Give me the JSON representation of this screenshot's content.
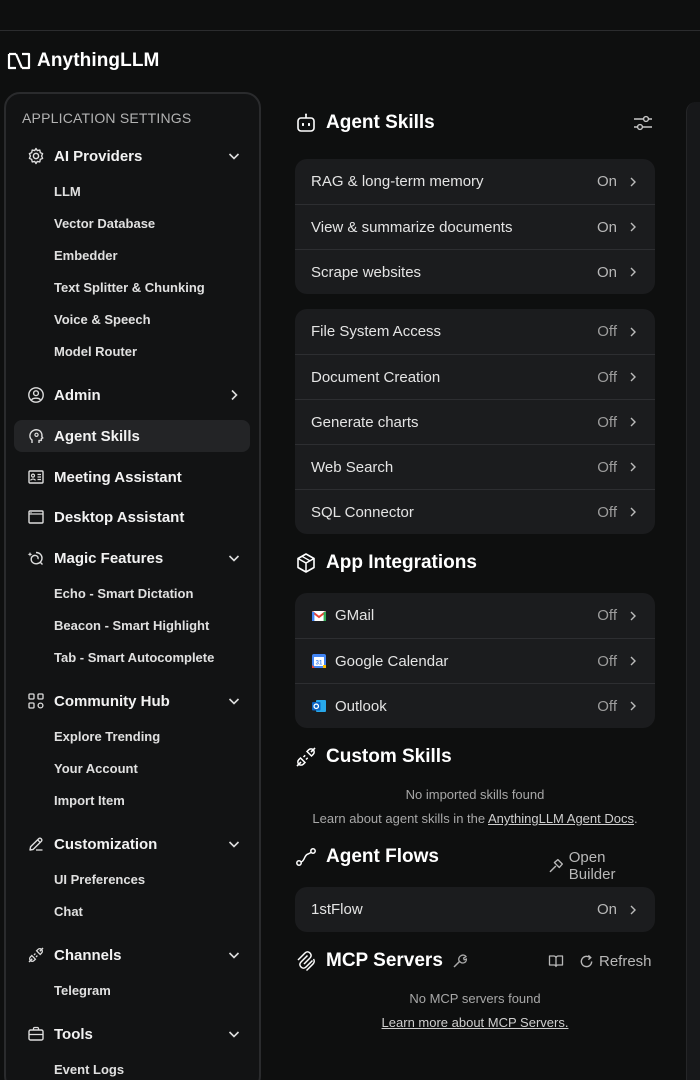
{
  "app": {
    "name": "AnythingLLM"
  },
  "sidebar": {
    "heading": "APPLICATION SETTINGS",
    "groups": [
      {
        "label": "AI Providers",
        "icon": "gear-icon",
        "expanded": true,
        "items": [
          "LLM",
          "Vector Database",
          "Embedder",
          "Text Splitter & Chunking",
          "Voice & Speech",
          "Model Router"
        ]
      },
      {
        "label": "Admin",
        "icon": "admin-user-icon",
        "expanded": false,
        "items": []
      },
      {
        "label": "Agent Skills",
        "icon": "agent-head-icon",
        "active": true,
        "items": []
      },
      {
        "label": "Meeting Assistant",
        "icon": "meeting-icon",
        "items": []
      },
      {
        "label": "Desktop Assistant",
        "icon": "desktop-window-icon",
        "items": []
      },
      {
        "label": "Magic Features",
        "icon": "magic-icon",
        "expanded": true,
        "items": [
          "Echo - Smart Dictation",
          "Beacon - Smart Highlight",
          "Tab - Smart Autocomplete"
        ]
      },
      {
        "label": "Community Hub",
        "icon": "community-grid-icon",
        "expanded": true,
        "items": [
          "Explore Trending",
          "Your Account",
          "Import Item"
        ]
      },
      {
        "label": "Customization",
        "icon": "pencil-icon",
        "expanded": true,
        "items": [
          "UI Preferences",
          "Chat"
        ]
      },
      {
        "label": "Channels",
        "icon": "plug-icon",
        "expanded": true,
        "items": [
          "Telegram"
        ]
      },
      {
        "label": "Tools",
        "icon": "briefcase-icon",
        "expanded": true,
        "items": [
          "Event Logs"
        ]
      }
    ]
  },
  "agent_skills": {
    "title": "Agent Skills",
    "group1": [
      {
        "label": "RAG & long-term memory",
        "status": "On"
      },
      {
        "label": "View & summarize documents",
        "status": "On"
      },
      {
        "label": "Scrape websites",
        "status": "On"
      }
    ],
    "group2": [
      {
        "label": "File System Access",
        "status": "Off"
      },
      {
        "label": "Document Creation",
        "status": "Off"
      },
      {
        "label": "Generate charts",
        "status": "Off"
      },
      {
        "label": "Web Search",
        "status": "Off"
      },
      {
        "label": "SQL Connector",
        "status": "Off"
      }
    ]
  },
  "app_integrations": {
    "title": "App Integrations",
    "items": [
      {
        "label": "GMail",
        "status": "Off",
        "icon": "gmail-icon"
      },
      {
        "label": "Google Calendar",
        "status": "Off",
        "icon": "google-calendar-icon"
      },
      {
        "label": "Outlook",
        "status": "Off",
        "icon": "outlook-icon"
      }
    ]
  },
  "custom_skills": {
    "title": "Custom Skills",
    "empty": "No imported skills found",
    "learn_prefix": "Learn about agent skills in the ",
    "learn_link": "AnythingLLM Agent Docs",
    "learn_suffix": "."
  },
  "agent_flows": {
    "title": "Agent Flows",
    "open_builder": "Open Builder",
    "items": [
      {
        "label": "1stFlow",
        "status": "On"
      }
    ]
  },
  "mcp_servers": {
    "title": "MCP Servers",
    "refresh": "Refresh",
    "empty": "No MCP servers found",
    "learn_link": "Learn more about MCP Servers."
  }
}
